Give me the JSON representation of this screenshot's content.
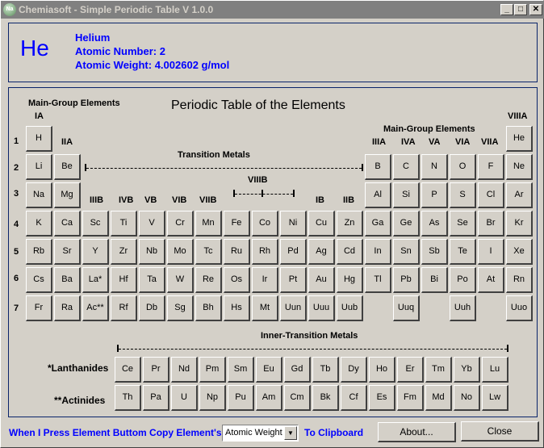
{
  "window": {
    "title": "Chemiasoft - Simple Periodic Table V 1.0.0",
    "app_icon_label": "Na",
    "controls": {
      "minimize": "_",
      "maximize": "□",
      "close": "✕"
    }
  },
  "selected_element": {
    "symbol": "He",
    "name": "Helium",
    "atomic_number_text": "Atomic Number: 2",
    "atomic_weight_text": "Atomic Weight: 4.002602 g/mol"
  },
  "table": {
    "title": "Periodic Table of the Elements",
    "labels": {
      "main_group_left": "Main-Group Elements",
      "main_group_right": "Main-Group Elements",
      "transition_metals": "Transition Metals",
      "inner_transition": "Inner-Transition Metals",
      "lanthanides": "*Lanthanides",
      "actinides": "**Actinides"
    },
    "group_labels": {
      "IA": "IA",
      "IIA": "IIA",
      "IIIB": "IIIB",
      "IVB": "IVB",
      "VB": "VB",
      "VIB": "VIB",
      "VIIB": "VIIB",
      "VIIIB": "VIIIB",
      "IB": "IB",
      "IIB": "IIB",
      "IIIA": "IIIA",
      "IVA": "IVA",
      "VA": "VA",
      "VIA": "VIA",
      "VIIA": "VIIA",
      "VIIIA": "VIIIA"
    },
    "periods": [
      "1",
      "2",
      "3",
      "4",
      "5",
      "6",
      "7"
    ],
    "elements": [
      {
        "s": "H",
        "r": 1,
        "c": 1
      },
      {
        "s": "He",
        "r": 1,
        "c": 18
      },
      {
        "s": "Li",
        "r": 2,
        "c": 1
      },
      {
        "s": "Be",
        "r": 2,
        "c": 2
      },
      {
        "s": "B",
        "r": 2,
        "c": 13
      },
      {
        "s": "C",
        "r": 2,
        "c": 14
      },
      {
        "s": "N",
        "r": 2,
        "c": 15
      },
      {
        "s": "O",
        "r": 2,
        "c": 16
      },
      {
        "s": "F",
        "r": 2,
        "c": 17
      },
      {
        "s": "Ne",
        "r": 2,
        "c": 18
      },
      {
        "s": "Na",
        "r": 3,
        "c": 1
      },
      {
        "s": "Mg",
        "r": 3,
        "c": 2
      },
      {
        "s": "Al",
        "r": 3,
        "c": 13
      },
      {
        "s": "Si",
        "r": 3,
        "c": 14
      },
      {
        "s": "P",
        "r": 3,
        "c": 15
      },
      {
        "s": "S",
        "r": 3,
        "c": 16
      },
      {
        "s": "Cl",
        "r": 3,
        "c": 17
      },
      {
        "s": "Ar",
        "r": 3,
        "c": 18
      },
      {
        "s": "K",
        "r": 4,
        "c": 1
      },
      {
        "s": "Ca",
        "r": 4,
        "c": 2
      },
      {
        "s": "Sc",
        "r": 4,
        "c": 3
      },
      {
        "s": "Ti",
        "r": 4,
        "c": 4
      },
      {
        "s": "V",
        "r": 4,
        "c": 5
      },
      {
        "s": "Cr",
        "r": 4,
        "c": 6
      },
      {
        "s": "Mn",
        "r": 4,
        "c": 7
      },
      {
        "s": "Fe",
        "r": 4,
        "c": 8
      },
      {
        "s": "Co",
        "r": 4,
        "c": 9
      },
      {
        "s": "Ni",
        "r": 4,
        "c": 10
      },
      {
        "s": "Cu",
        "r": 4,
        "c": 11
      },
      {
        "s": "Zn",
        "r": 4,
        "c": 12
      },
      {
        "s": "Ga",
        "r": 4,
        "c": 13
      },
      {
        "s": "Ge",
        "r": 4,
        "c": 14
      },
      {
        "s": "As",
        "r": 4,
        "c": 15
      },
      {
        "s": "Se",
        "r": 4,
        "c": 16
      },
      {
        "s": "Br",
        "r": 4,
        "c": 17
      },
      {
        "s": "Kr",
        "r": 4,
        "c": 18
      },
      {
        "s": "Rb",
        "r": 5,
        "c": 1
      },
      {
        "s": "Sr",
        "r": 5,
        "c": 2
      },
      {
        "s": "Y",
        "r": 5,
        "c": 3
      },
      {
        "s": "Zr",
        "r": 5,
        "c": 4
      },
      {
        "s": "Nb",
        "r": 5,
        "c": 5
      },
      {
        "s": "Mo",
        "r": 5,
        "c": 6
      },
      {
        "s": "Tc",
        "r": 5,
        "c": 7
      },
      {
        "s": "Ru",
        "r": 5,
        "c": 8
      },
      {
        "s": "Rh",
        "r": 5,
        "c": 9
      },
      {
        "s": "Pd",
        "r": 5,
        "c": 10
      },
      {
        "s": "Ag",
        "r": 5,
        "c": 11
      },
      {
        "s": "Cd",
        "r": 5,
        "c": 12
      },
      {
        "s": "In",
        "r": 5,
        "c": 13
      },
      {
        "s": "Sn",
        "r": 5,
        "c": 14
      },
      {
        "s": "Sb",
        "r": 5,
        "c": 15
      },
      {
        "s": "Te",
        "r": 5,
        "c": 16
      },
      {
        "s": "I",
        "r": 5,
        "c": 17
      },
      {
        "s": "Xe",
        "r": 5,
        "c": 18
      },
      {
        "s": "Cs",
        "r": 6,
        "c": 1
      },
      {
        "s": "Ba",
        "r": 6,
        "c": 2
      },
      {
        "s": "La*",
        "r": 6,
        "c": 3
      },
      {
        "s": "Hf",
        "r": 6,
        "c": 4
      },
      {
        "s": "Ta",
        "r": 6,
        "c": 5
      },
      {
        "s": "W",
        "r": 6,
        "c": 6
      },
      {
        "s": "Re",
        "r": 6,
        "c": 7
      },
      {
        "s": "Os",
        "r": 6,
        "c": 8
      },
      {
        "s": "Ir",
        "r": 6,
        "c": 9
      },
      {
        "s": "Pt",
        "r": 6,
        "c": 10
      },
      {
        "s": "Au",
        "r": 6,
        "c": 11
      },
      {
        "s": "Hg",
        "r": 6,
        "c": 12
      },
      {
        "s": "Tl",
        "r": 6,
        "c": 13
      },
      {
        "s": "Pb",
        "r": 6,
        "c": 14
      },
      {
        "s": "Bi",
        "r": 6,
        "c": 15
      },
      {
        "s": "Po",
        "r": 6,
        "c": 16
      },
      {
        "s": "At",
        "r": 6,
        "c": 17
      },
      {
        "s": "Rn",
        "r": 6,
        "c": 18
      },
      {
        "s": "Fr",
        "r": 7,
        "c": 1
      },
      {
        "s": "Ra",
        "r": 7,
        "c": 2
      },
      {
        "s": "Ac**",
        "r": 7,
        "c": 3
      },
      {
        "s": "Rf",
        "r": 7,
        "c": 4
      },
      {
        "s": "Db",
        "r": 7,
        "c": 5
      },
      {
        "s": "Sg",
        "r": 7,
        "c": 6
      },
      {
        "s": "Bh",
        "r": 7,
        "c": 7
      },
      {
        "s": "Hs",
        "r": 7,
        "c": 8
      },
      {
        "s": "Mt",
        "r": 7,
        "c": 9
      },
      {
        "s": "Uun",
        "r": 7,
        "c": 10
      },
      {
        "s": "Uuu",
        "r": 7,
        "c": 11
      },
      {
        "s": "Uub",
        "r": 7,
        "c": 12
      },
      {
        "s": "Uuq",
        "r": 7,
        "c": 14
      },
      {
        "s": "Uuh",
        "r": 7,
        "c": 16
      },
      {
        "s": "Uuo",
        "r": 7,
        "c": 18
      }
    ],
    "lanthanides": [
      "Ce",
      "Pr",
      "Nd",
      "Pm",
      "Sm",
      "Eu",
      "Gd",
      "Tb",
      "Dy",
      "Ho",
      "Er",
      "Tm",
      "Yb",
      "Lu"
    ],
    "actinides": [
      "Th",
      "Pa",
      "U",
      "Np",
      "Pu",
      "Am",
      "Cm",
      "Bk",
      "Cf",
      "Es",
      "Fm",
      "Md",
      "No",
      "Lw"
    ]
  },
  "footer": {
    "prefix_text": "When I Press Element Buttom Copy Element's",
    "copy_option": "Atomic Weight",
    "suffix_text": "To Clipboard",
    "about_label": "About...",
    "close_label": "Close"
  }
}
